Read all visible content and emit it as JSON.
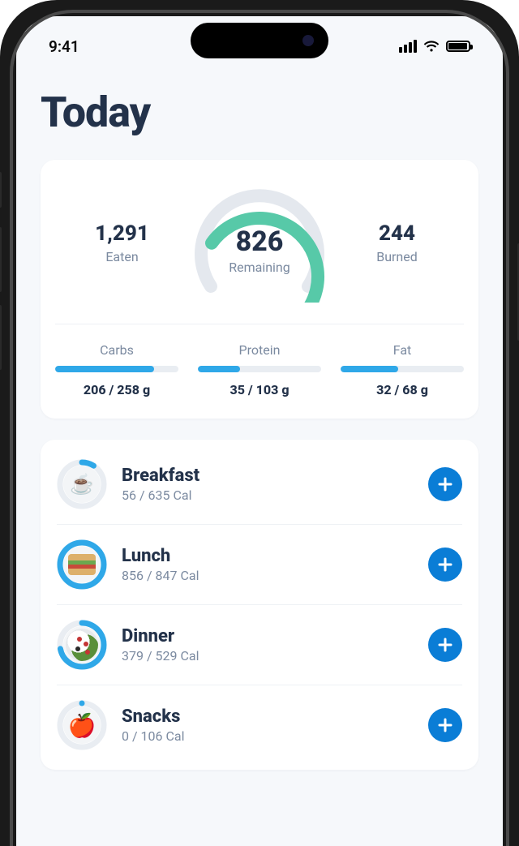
{
  "status": {
    "time": "9:41"
  },
  "page_title": "Today",
  "summary": {
    "eaten": {
      "value": "1,291",
      "label": "Eaten"
    },
    "remaining": {
      "value": "826",
      "label": "Remaining",
      "progress_deg": 210
    },
    "burned": {
      "value": "244",
      "label": "Burned"
    }
  },
  "macros": [
    {
      "label": "Carbs",
      "value": "206 / 258 g",
      "pct": 80
    },
    {
      "label": "Protein",
      "value": "35 / 103 g",
      "pct": 34
    },
    {
      "label": "Fat",
      "value": "32 / 68 g",
      "pct": 47
    }
  ],
  "meals": [
    {
      "name": "Breakfast",
      "cals": "56 / 635 Cal",
      "pct": 9,
      "icon": "coffee"
    },
    {
      "name": "Lunch",
      "cals": "856 / 847 Cal",
      "pct": 100,
      "icon": "sandwich"
    },
    {
      "name": "Dinner",
      "cals": "379 / 529 Cal",
      "pct": 72,
      "icon": "salad"
    },
    {
      "name": "Snacks",
      "cals": "0 / 106 Cal",
      "pct": 0,
      "icon": "apple"
    }
  ]
}
